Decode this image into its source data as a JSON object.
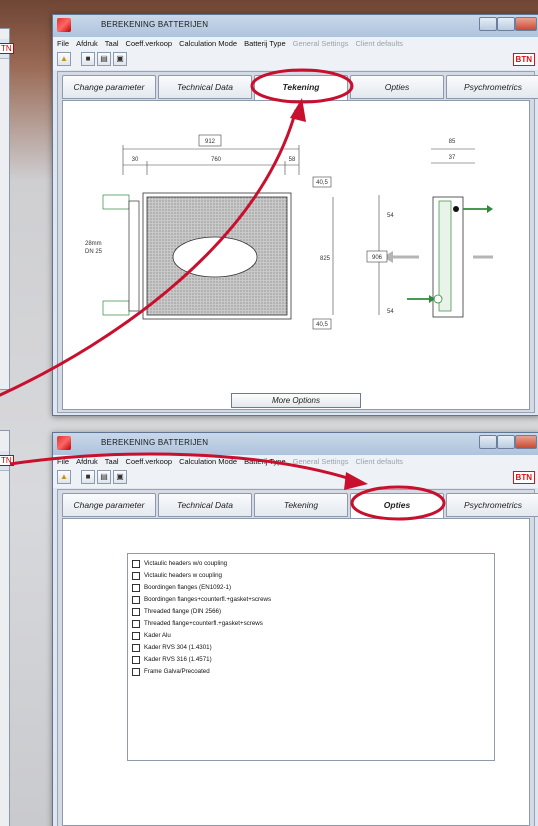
{
  "window_top": {
    "title": "BEREKENING BATTERIJEN",
    "menu": [
      "File",
      "Afdruk",
      "Taal",
      "Coeff.verkoop",
      "Calculation Mode",
      "Batterij Type",
      "General Settings",
      "Client defaults"
    ],
    "logo": "BTN",
    "tabs": [
      "Change parameter",
      "Technical Data",
      "Tekening",
      "Opties",
      "Psychrometrics"
    ],
    "active_tab": "Tekening",
    "drawing": {
      "dim_total_width": "912",
      "dim_left": "30",
      "dim_center": "760",
      "dim_right": "58",
      "dim_top_right": "40,5",
      "dim_height": "825",
      "dim_bottom_right": "40,5",
      "connection_label_1": "28mm",
      "connection_label_2": "DN 25",
      "side_width": "85",
      "side_inner": "37",
      "side_top": "54",
      "side_middle": "906",
      "side_bottom": "54"
    },
    "more_options": "More Options"
  },
  "window_bottom": {
    "title": "BEREKENING BATTERIJEN",
    "menu": [
      "File",
      "Afdruk",
      "Taal",
      "Coeff.verkoop",
      "Calculation Mode",
      "Batterij Type",
      "General Settings",
      "Client defaults"
    ],
    "logo": "BTN",
    "tabs": [
      "Change parameter",
      "Technical Data",
      "Tekening",
      "Opties",
      "Psychrometrics"
    ],
    "active_tab": "Opties",
    "options": [
      "Victaulic headers w/o coupling",
      "Victaulic headers w coupling",
      "Boordingen flanges  (EN1092-1)",
      "Boordingen flanges+counterfl.+gasket+screws",
      "Threaded flange (DIN 2566)",
      "Threaded flange+counterfl.+gasket+screws",
      "Kader Alu",
      "Kader RVS 304 (1.4301)",
      "Kader RVS 316 (1.4571)",
      "Frame Galva/Precoated"
    ]
  },
  "background_fragments": {
    "logo_top": "TN",
    "logo_bottom": "TN"
  },
  "colors": {
    "annotation_red": "#c8102e",
    "arrow_green": "#2e8b3a",
    "arrow_grey": "#b5b5b5",
    "hatch": "#a9a9a9"
  },
  "icons": [
    "app-icon",
    "open-folder-icon",
    "save-icon",
    "print-icon",
    "preview-icon",
    "minimize-icon",
    "maximize-icon",
    "close-icon"
  ]
}
